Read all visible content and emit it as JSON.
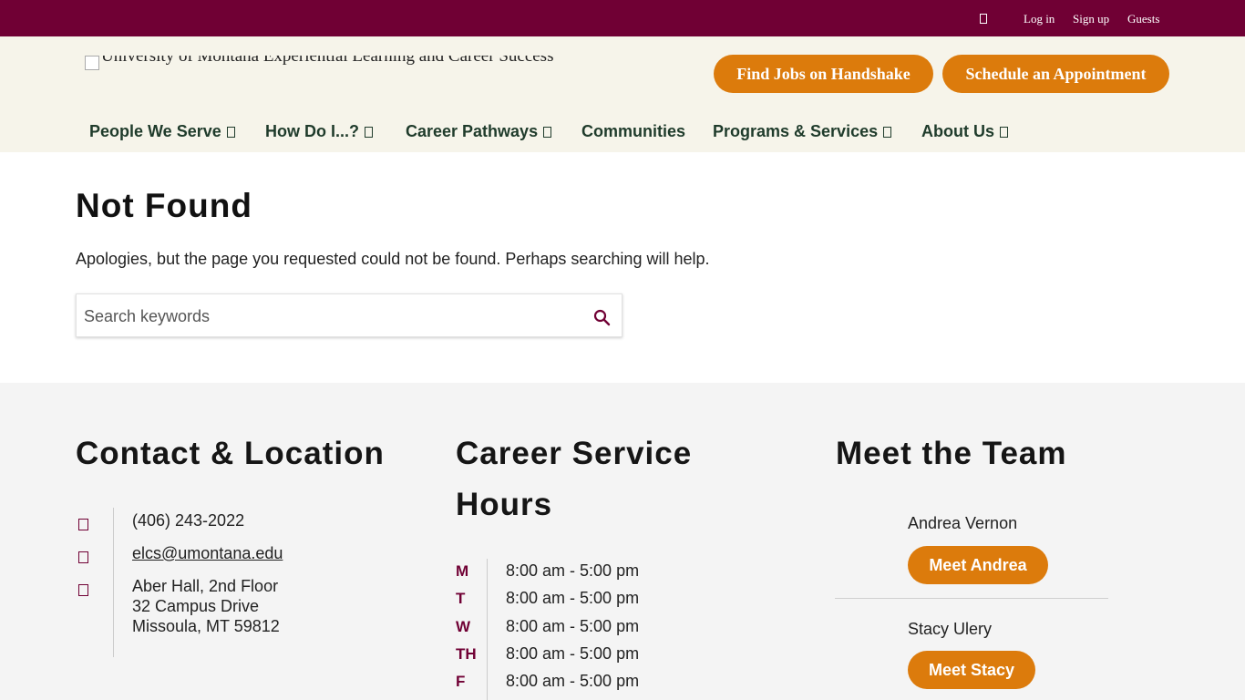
{
  "topbar": {
    "icon": "box-icon",
    "login": "Log in",
    "signup": "Sign up",
    "guests": "Guests"
  },
  "header": {
    "logo_alt": "University of Montana Experiential Learning and Career Success",
    "find_jobs": "Find Jobs on Handshake",
    "schedule": "Schedule an Appointment"
  },
  "nav": {
    "items": [
      {
        "label": "People We Serve"
      },
      {
        "label": "How Do I...?"
      },
      {
        "label": "Career Pathways"
      },
      {
        "label": "Communities"
      },
      {
        "label": "Programs & Services"
      },
      {
        "label": "About Us"
      }
    ]
  },
  "main": {
    "title": "Not Found",
    "message": "Apologies, but the page you requested could not be found. Perhaps searching will help.",
    "search_placeholder": "Search keywords"
  },
  "footer": {
    "contact": {
      "heading": "Contact & Location",
      "phone": "(406) 243-2022",
      "email": "elcs@umontana.edu",
      "address_line1": "Aber Hall, 2nd Floor",
      "address_line2": "32 Campus Drive",
      "address_line3": "Missoula, MT 59812"
    },
    "hours": {
      "heading_line1": "Career Service",
      "heading_line2": "Hours",
      "days": [
        {
          "day": "M",
          "time": "8:00 am - 5:00 pm"
        },
        {
          "day": "T",
          "time": "8:00 am - 5:00 pm"
        },
        {
          "day": "W",
          "time": "8:00 am - 5:00 pm"
        },
        {
          "day": "TH",
          "time": "8:00 am - 5:00 pm"
        },
        {
          "day": "F",
          "time": "8:00 am - 5:00 pm"
        }
      ]
    },
    "team": {
      "heading": "Meet the Team",
      "members": [
        {
          "name": "Andrea Vernon",
          "button": "Meet Andrea"
        },
        {
          "name": "Stacy Ulery",
          "button": "Meet Stacy"
        }
      ]
    }
  },
  "colors": {
    "maroon": "#700034",
    "orange": "#dc7b0c",
    "cream": "#f6f4ea",
    "nav_green": "#1f3b2b"
  }
}
